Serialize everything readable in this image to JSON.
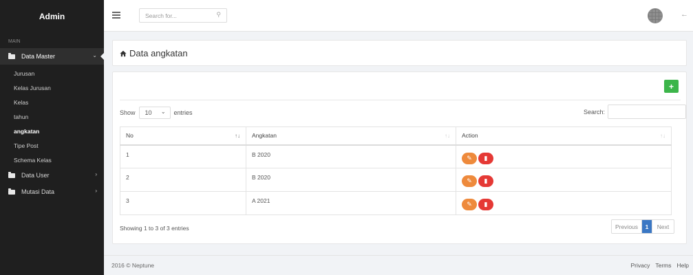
{
  "sidebar": {
    "brand": "Admin",
    "section": "MAIN",
    "menu": {
      "data_master": "Data Master",
      "data_user": "Data User",
      "mutasi_data": "Mutasi Data"
    },
    "sub_items": [
      "Jurusan",
      "Kelas Jurusan",
      "Kelas",
      "tahun",
      "angkatan",
      "Tipe Post",
      "Schema Kelas"
    ]
  },
  "topbar": {
    "search_placeholder": "Search for..."
  },
  "page": {
    "title": "Data angkatan"
  },
  "table_controls": {
    "show_label": "Show",
    "page_length": "10",
    "entries_label": "entries",
    "search_label": "Search:"
  },
  "table": {
    "headers": [
      "No",
      "Angkatan",
      "Action"
    ],
    "rows": [
      {
        "no": "1",
        "angkatan": "B 2020"
      },
      {
        "no": "2",
        "angkatan": "B 2020"
      },
      {
        "no": "3",
        "angkatan": "A 2021"
      }
    ]
  },
  "pagination": {
    "info": "Showing 1 to 3 of 3 entries",
    "previous": "Previous",
    "current": "1",
    "next": "Next"
  },
  "footer": {
    "copyright": "2016 © Neptune",
    "links": [
      "Privacy",
      "Terms",
      "Help"
    ]
  },
  "colors": {
    "sidebar_bg": "#1f1f1f",
    "add_button": "#3cb54a",
    "edit_button": "#ee8a3c",
    "delete_button": "#e53935",
    "active_page": "#3a77c4"
  }
}
